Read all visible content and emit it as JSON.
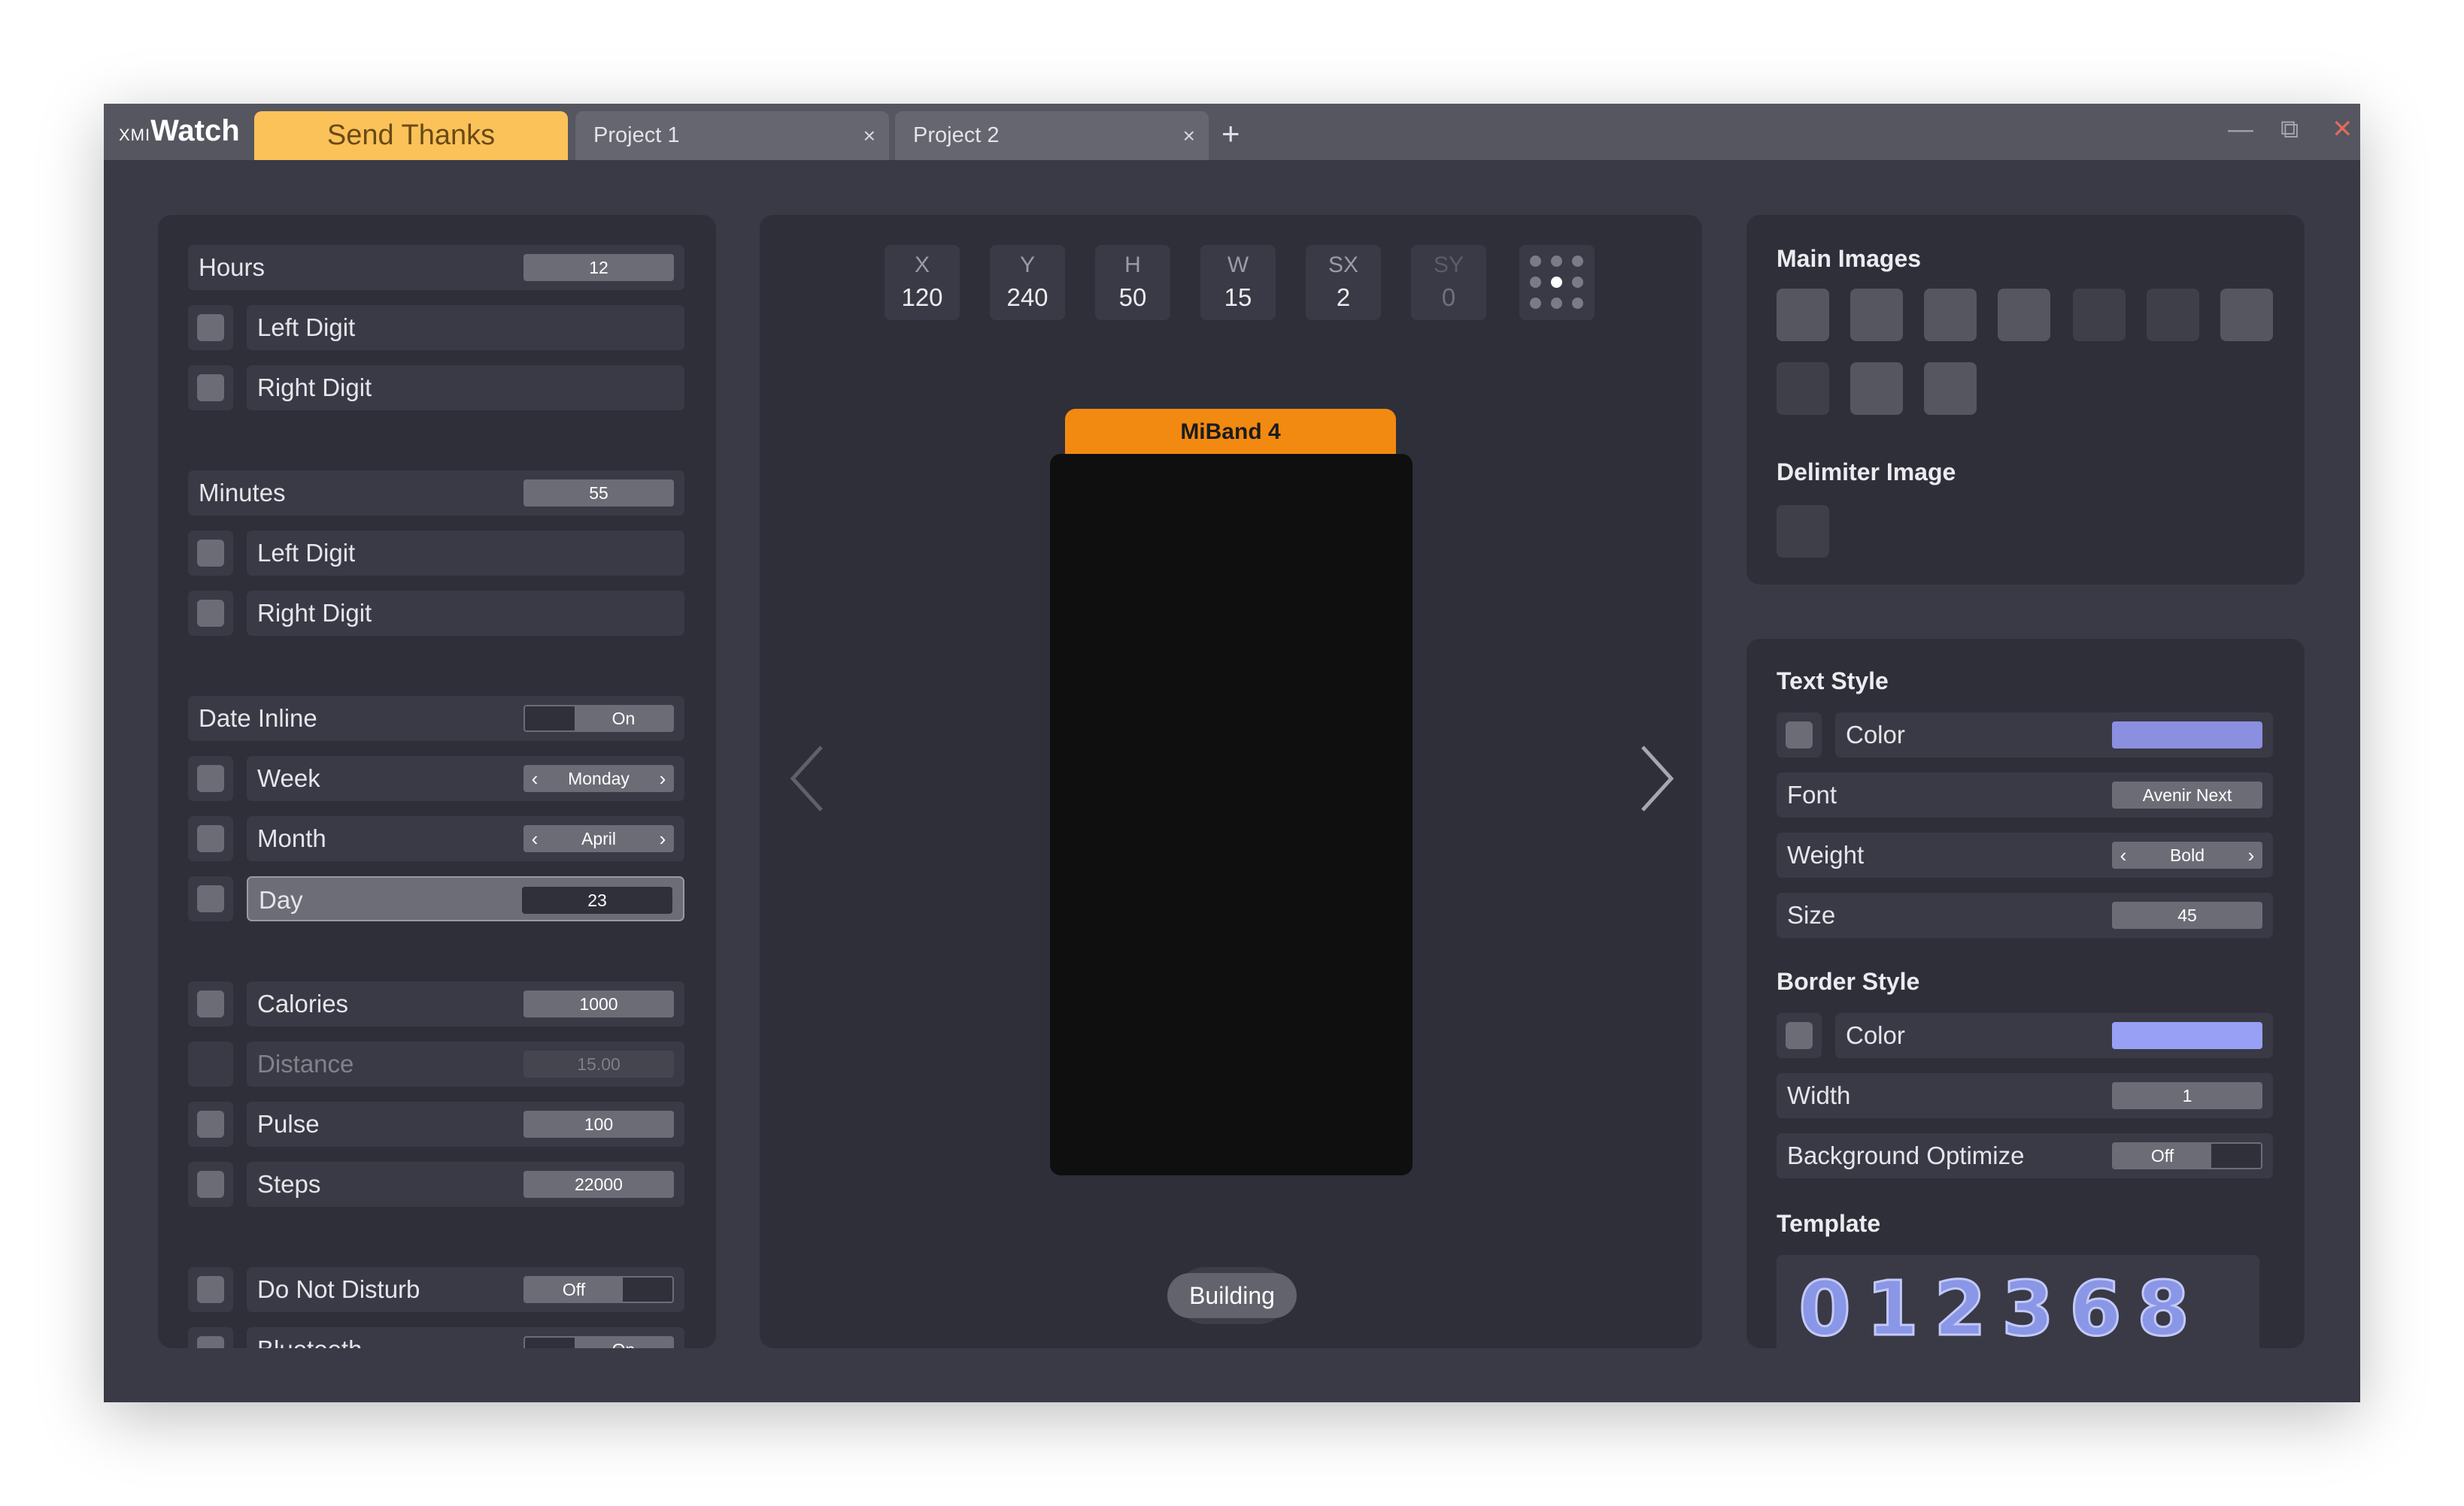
{
  "app": {
    "logo_small": "XMI",
    "logo_main": "Watch"
  },
  "tabs": {
    "send_thanks": "Send Thanks",
    "project1": "Project 1",
    "project2": "Project 2",
    "close_glyph": "×",
    "add_glyph": "+"
  },
  "window_controls": {
    "minimize": "—",
    "maximize": "⧉",
    "close": "✕"
  },
  "left": {
    "hours": {
      "label": "Hours",
      "value": "12",
      "left": "Left Digit",
      "right": "Right Digit"
    },
    "minutes": {
      "label": "Minutes",
      "value": "55",
      "left": "Left Digit",
      "right": "Right Digit"
    },
    "date_inline": {
      "label": "Date Inline",
      "value": "On"
    },
    "week": {
      "label": "Week",
      "value": "Monday"
    },
    "month": {
      "label": "Month",
      "value": "April"
    },
    "day": {
      "label": "Day",
      "value": "23"
    },
    "calories": {
      "label": "Calories",
      "value": "1000"
    },
    "distance": {
      "label": "Distance",
      "value": "15.00"
    },
    "pulse": {
      "label": "Pulse",
      "value": "100"
    },
    "steps": {
      "label": "Steps",
      "value": "22000"
    },
    "dnd": {
      "label": "Do Not Disturb",
      "value": "Off"
    },
    "bluetooth": {
      "label": "Bluetooth",
      "value": "On"
    },
    "arrow_left": "‹",
    "arrow_right": "›"
  },
  "center": {
    "coords": [
      {
        "key": "X",
        "value": "120"
      },
      {
        "key": "Y",
        "value": "240"
      },
      {
        "key": "H",
        "value": "50"
      },
      {
        "key": "W",
        "value": "15"
      },
      {
        "key": "SX",
        "value": "2"
      },
      {
        "key": "SY",
        "value": "0"
      }
    ],
    "device": "MiBand 4",
    "status": "Building"
  },
  "right": {
    "main_images": "Main Images",
    "delimiter_image": "Delimiter Image",
    "text_style": {
      "title": "Text Style",
      "color_label": "Color",
      "color": "#8b8fe0",
      "font_label": "Font",
      "font": "Avenir Next",
      "weight_label": "Weight",
      "weight": "Bold",
      "size_label": "Size",
      "size": "45"
    },
    "border_style": {
      "title": "Border Style",
      "color_label": "Color",
      "color": "#97a0f5",
      "width_label": "Width",
      "width": "1",
      "bg_opt_label": "Background Optimize",
      "bg_opt": "Off"
    },
    "template": {
      "title": "Template",
      "digits": [
        "0",
        "1",
        "2",
        "3",
        "6",
        "8"
      ]
    }
  },
  "colors": {
    "accent_tab": "#fbc25a",
    "device_tab": "#f28a12",
    "digit": "#8a96e6"
  }
}
